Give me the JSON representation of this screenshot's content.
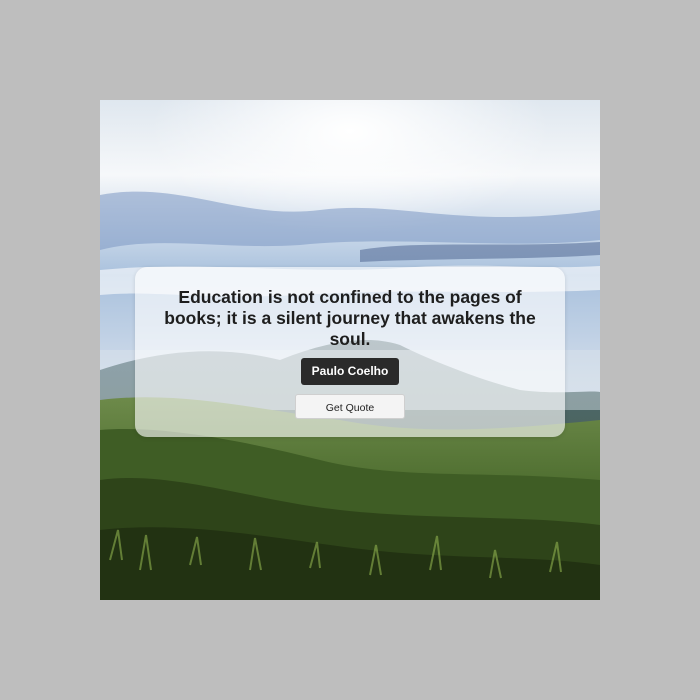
{
  "quote": {
    "text": "Education is not confined to the pages of books; it is a silent journey that awakens the soul.",
    "author": "Paulo Coelho"
  },
  "actions": {
    "get_quote_label": "Get Quote"
  },
  "background": {
    "image_description_icon": "landscape-photo",
    "sky_color": "#9fb8d8",
    "hill_color": "#4c6b2f"
  }
}
